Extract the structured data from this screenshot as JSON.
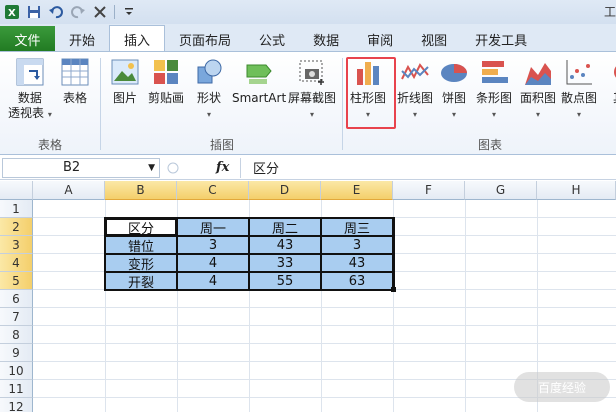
{
  "qat": {
    "title_fragment": "工",
    "icons": [
      "excel-logo-icon",
      "save-icon",
      "undo-icon",
      "redo-icon",
      "customize-icon"
    ]
  },
  "ribbon_tabs": {
    "file": "文件",
    "tabs": [
      "开始",
      "插入",
      "页面布局",
      "公式",
      "数据",
      "审阅",
      "视图",
      "开发工具"
    ],
    "active": "插入"
  },
  "ribbon": {
    "groups": {
      "tables": "表格",
      "illustrations": "插图",
      "charts": "图表"
    },
    "buttons": {
      "pivot_table": "数据\n透视表",
      "table": "表格",
      "picture": "图片",
      "clip_art": "剪贴画",
      "shapes": "形状",
      "smartart": "SmartArt",
      "screenshot": "屏幕截图",
      "column_chart": "柱形图",
      "line_chart": "折线图",
      "pie_chart": "饼图",
      "bar_chart": "条形图",
      "area_chart": "面积图",
      "scatter_chart": "散点图",
      "other_chart": "其"
    },
    "highlighted": "柱形图",
    "highlight_color": "#e8434d"
  },
  "formula_bar": {
    "name_box": "B2",
    "fx": "fx",
    "content": "区分"
  },
  "sheet": {
    "columns": [
      "A",
      "B",
      "C",
      "D",
      "E",
      "F",
      "G",
      "H"
    ],
    "selected_columns": [
      "B",
      "C",
      "D",
      "E"
    ],
    "rows": [
      "1",
      "2",
      "3",
      "4",
      "5",
      "6",
      "7",
      "8",
      "9",
      "10",
      "11",
      "12"
    ],
    "selected_rows": [
      "2",
      "3",
      "4",
      "5"
    ],
    "table": {
      "header": [
        "区分",
        "周一",
        "周二",
        "周三"
      ],
      "rows": [
        [
          "错位",
          "3",
          "43",
          "3"
        ],
        [
          "变形",
          "4",
          "33",
          "43"
        ],
        [
          "开裂",
          "4",
          "55",
          "63"
        ]
      ]
    },
    "selection_fill": "#a9cdf0",
    "active_cell": "B2"
  },
  "watermark": "百度经验"
}
